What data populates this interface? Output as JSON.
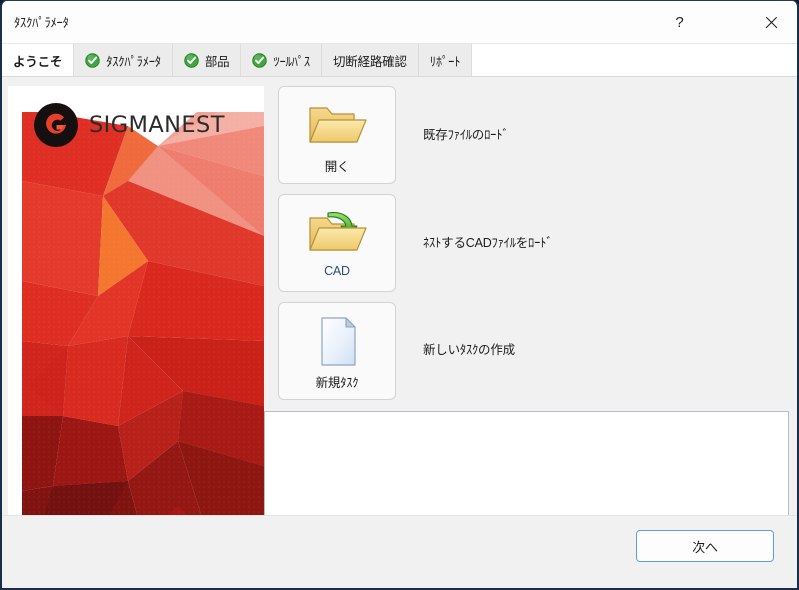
{
  "window": {
    "title": "ﾀｽｸﾊﾟﾗﾒｰﾀ",
    "help_label": "?",
    "close_label": "×"
  },
  "tabs": [
    {
      "label": "ようこそ",
      "active": true,
      "has_check": false
    },
    {
      "label": "ﾀｽｸﾊﾟﾗﾒｰﾀ",
      "active": false,
      "has_check": true
    },
    {
      "label": "部品",
      "active": false,
      "has_check": true
    },
    {
      "label": "ﾂｰﾙﾊﾟｽ",
      "active": false,
      "has_check": true
    },
    {
      "label": "切断経路確認",
      "active": false,
      "has_check": false
    },
    {
      "label": "ﾘﾎﾟｰﾄ",
      "active": false,
      "has_check": false
    }
  ],
  "branding": {
    "product_name": "SIGMANEST",
    "logo_circle_color": "#15100f",
    "logo_mark_color": "#e8402a",
    "accent_color": "#e03127"
  },
  "actions": [
    {
      "id": "open",
      "icon": "open-folder-icon",
      "label": "開く",
      "label_style": "dark",
      "description": "既存ﾌｧｲﾙのﾛｰﾄﾞ"
    },
    {
      "id": "cad",
      "icon": "folder-import-icon",
      "label": "CAD",
      "label_style": "blue",
      "description": "ﾈｽﾄするCADﾌｧｲﾙをﾛｰﾄﾞ"
    },
    {
      "id": "new",
      "icon": "new-document-icon",
      "label": "新規ﾀｽｸ",
      "label_style": "dark",
      "description": "新しいﾀｽｸの作成"
    }
  ],
  "notes": {
    "value": "",
    "placeholder": ""
  },
  "footer": {
    "next_label": "次へ"
  }
}
